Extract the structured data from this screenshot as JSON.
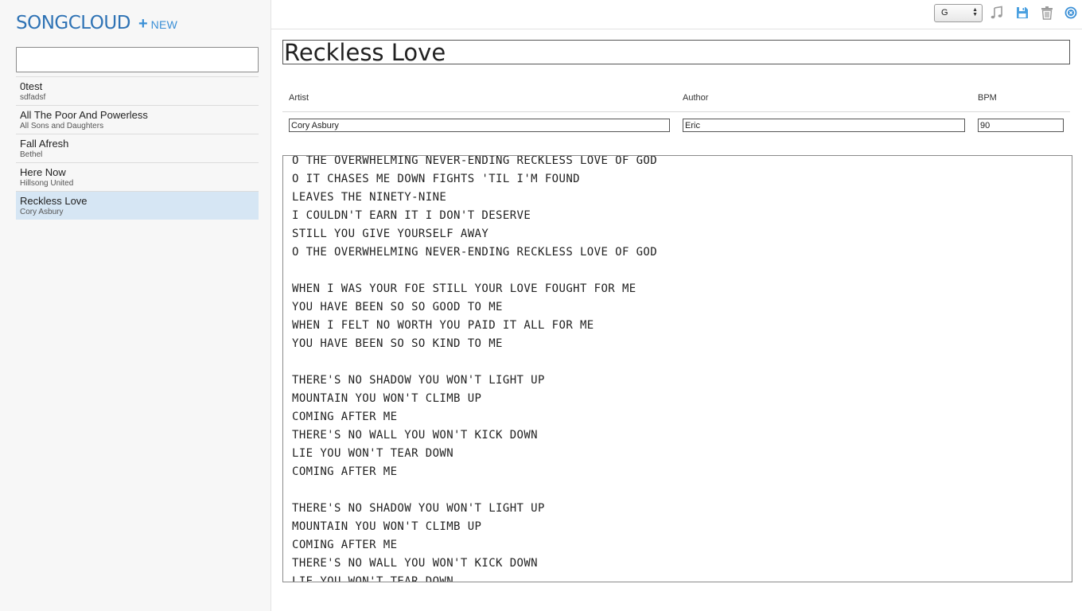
{
  "app": {
    "brand": "SONGCLOUD",
    "new_label": "NEW"
  },
  "search": {
    "value": "",
    "placeholder": ""
  },
  "songs": [
    {
      "title": "0test",
      "artist": "sdfadsf"
    },
    {
      "title": "All The Poor And Powerless",
      "artist": "All Sons and Daughters"
    },
    {
      "title": "Fall Afresh",
      "artist": "Bethel"
    },
    {
      "title": "Here Now",
      "artist": "Hillsong United"
    },
    {
      "title": "Reckless Love",
      "artist": "Cory Asbury"
    }
  ],
  "selected_song_index": 4,
  "toolbar": {
    "key_value": "G",
    "icons": [
      "music-note-icon",
      "save-icon",
      "trash-icon",
      "close-circle-icon"
    ]
  },
  "editor": {
    "title": "Reckless Love",
    "labels": {
      "artist": "Artist",
      "author": "Author",
      "bpm": "BPM"
    },
    "artist": "Cory Asbury",
    "author": "Eric",
    "bpm": "90",
    "lyrics": "O THE OVERWHELMING NEVER-ENDING RECKLESS LOVE OF GOD\nO IT CHASES ME DOWN FIGHTS 'TIL I'M FOUND\nLEAVES THE NINETY-NINE\nI COULDN'T EARN IT I DON'T DESERVE\nSTILL YOU GIVE YOURSELF AWAY\nO THE OVERWHELMING NEVER-ENDING RECKLESS LOVE OF GOD\n\nWHEN I WAS YOUR FOE STILL YOUR LOVE FOUGHT FOR ME\nYOU HAVE BEEN SO SO GOOD TO ME\nWHEN I FELT NO WORTH YOU PAID IT ALL FOR ME\nYOU HAVE BEEN SO SO KIND TO ME\n\nTHERE'S NO SHADOW YOU WON'T LIGHT UP\nMOUNTAIN YOU WON'T CLIMB UP\nCOMING AFTER ME\nTHERE'S NO WALL YOU WON'T KICK DOWN\nLIE YOU WON'T TEAR DOWN\nCOMING AFTER ME\n\nTHERE'S NO SHADOW YOU WON'T LIGHT UP\nMOUNTAIN YOU WON'T CLIMB UP\nCOMING AFTER ME\nTHERE'S NO WALL YOU WON'T KICK DOWN\nLIE YOU WON'T TEAR DOWN"
  },
  "colors": {
    "brand": "#2f73b5",
    "accent": "#3a8fd6",
    "selected_row": "#d6e6f4",
    "icon_gray": "#9a9a9a"
  }
}
